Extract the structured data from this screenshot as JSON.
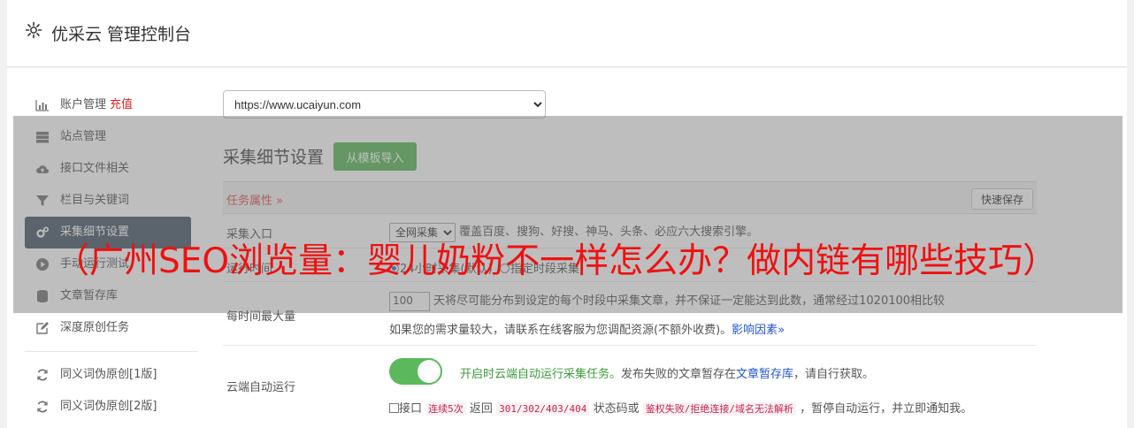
{
  "header": {
    "title": "优采云 管理控制台"
  },
  "sidebar": {
    "account": {
      "label": "账户管理",
      "recharge": "充值"
    },
    "items": [
      {
        "label": "站点管理",
        "icon": "server-icon"
      },
      {
        "label": "接口文件相关",
        "icon": "cloud-upload-icon"
      },
      {
        "label": "栏目与关键词",
        "icon": "filter-icon"
      },
      {
        "label": "采集细节设置",
        "icon": "gears-icon",
        "active": true
      },
      {
        "label": "手动运行测试",
        "icon": "play-icon"
      },
      {
        "label": "文章暂存库",
        "icon": "database-icon"
      },
      {
        "label": "深度原创任务",
        "icon": "edit-icon"
      }
    ],
    "extra": [
      {
        "label": "同义词伪原创[1版]",
        "icon": "refresh-icon"
      },
      {
        "label": "同义词伪原创[2版]",
        "icon": "refresh-icon"
      }
    ]
  },
  "site_select": {
    "value": "https://www.ucaiyun.com"
  },
  "section": {
    "title": "采集细节设置",
    "import_button": "从模板导入"
  },
  "task_attr": {
    "label": "任务属性 »",
    "save_button": "快速保存"
  },
  "rows": {
    "entry": {
      "label": "采集入口",
      "select": "全网采集",
      "desc": "覆盖百度、搜狗、好搜、神马、头条、必应六大搜索引擎。"
    },
    "runtime": {
      "label": "运行时间",
      "opt1": "24小时采集(默认)",
      "opt2": "指定时段采集"
    },
    "max": {
      "label": "每时间最大量",
      "value": "100",
      "desc": "天将尽可能分布到设定的每个时段中采集文章，并不保证一定能达到此数，通常经过1020100相比较",
      "hint": "如果您的需求量较大，请联系在线客服为您调配资源(不额外收费)。",
      "link": "影响因素"
    },
    "cloud": {
      "label": "云端自动运行",
      "toggle_text": "开启时云端自动运行采集任务。",
      "desc1": "发布失败的文章暂存在",
      "link": "文章暂存库",
      "desc2": "，请自行获取。",
      "chk_label": "接口",
      "code1": "连续5次",
      "t1": "返回",
      "code2": "301/302/403/404",
      "t2": "状态码或",
      "code3": "鉴权失败/拒绝连接/域名无法解析",
      "t3": "，暂停自动运行，并立即通知我。"
    }
  },
  "overlay": {
    "title": "（广州SEO浏览量：婴儿奶粉不一样怎么办？做内链有哪些技巧）"
  },
  "colors": {
    "accent_green": "#5cb85c",
    "active_nav": "#4c5a6b",
    "overlay_red": "#ee1111"
  }
}
